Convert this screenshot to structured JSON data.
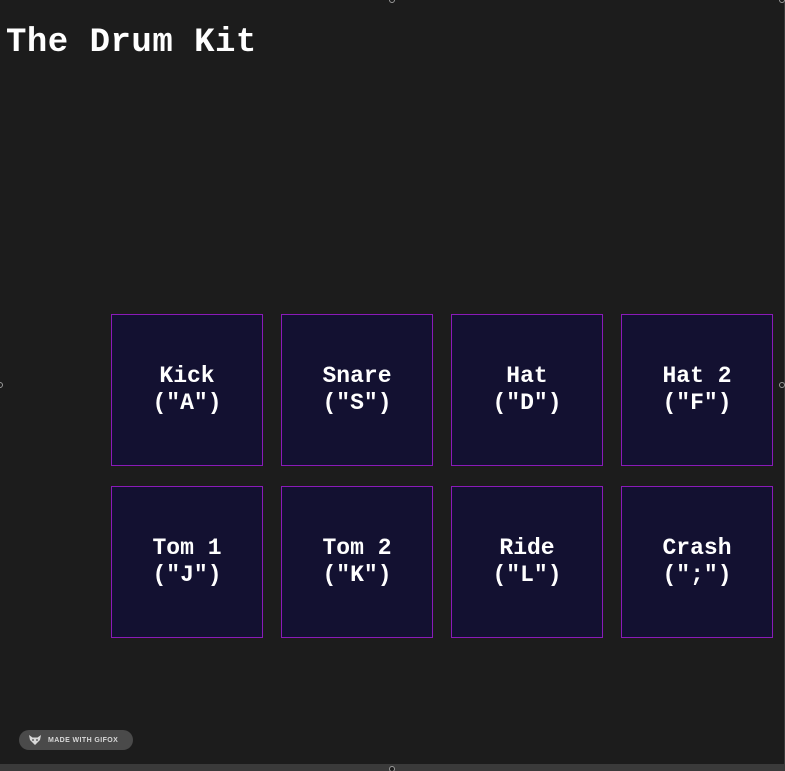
{
  "page": {
    "title": "The Drum Kit"
  },
  "pads": [
    {
      "name": "Kick",
      "key": "(\"A\")"
    },
    {
      "name": "Snare",
      "key": "(\"S\")"
    },
    {
      "name": "Hat",
      "key": "(\"D\")"
    },
    {
      "name": "Hat 2",
      "key": "(\"F\")"
    },
    {
      "name": "Tom 1",
      "key": "(\"J\")"
    },
    {
      "name": "Tom 2",
      "key": "(\"K\")"
    },
    {
      "name": "Ride",
      "key": "(\"L\")"
    },
    {
      "name": "Crash",
      "key": "(\";\")"
    }
  ],
  "badge": {
    "label": "MADE WITH GIFOX",
    "icon": "fox-icon"
  },
  "colors": {
    "background": "#1c1c1c",
    "pad_fill": "#131131",
    "pad_border": "#8a1ab8",
    "text": "#ffffff"
  }
}
